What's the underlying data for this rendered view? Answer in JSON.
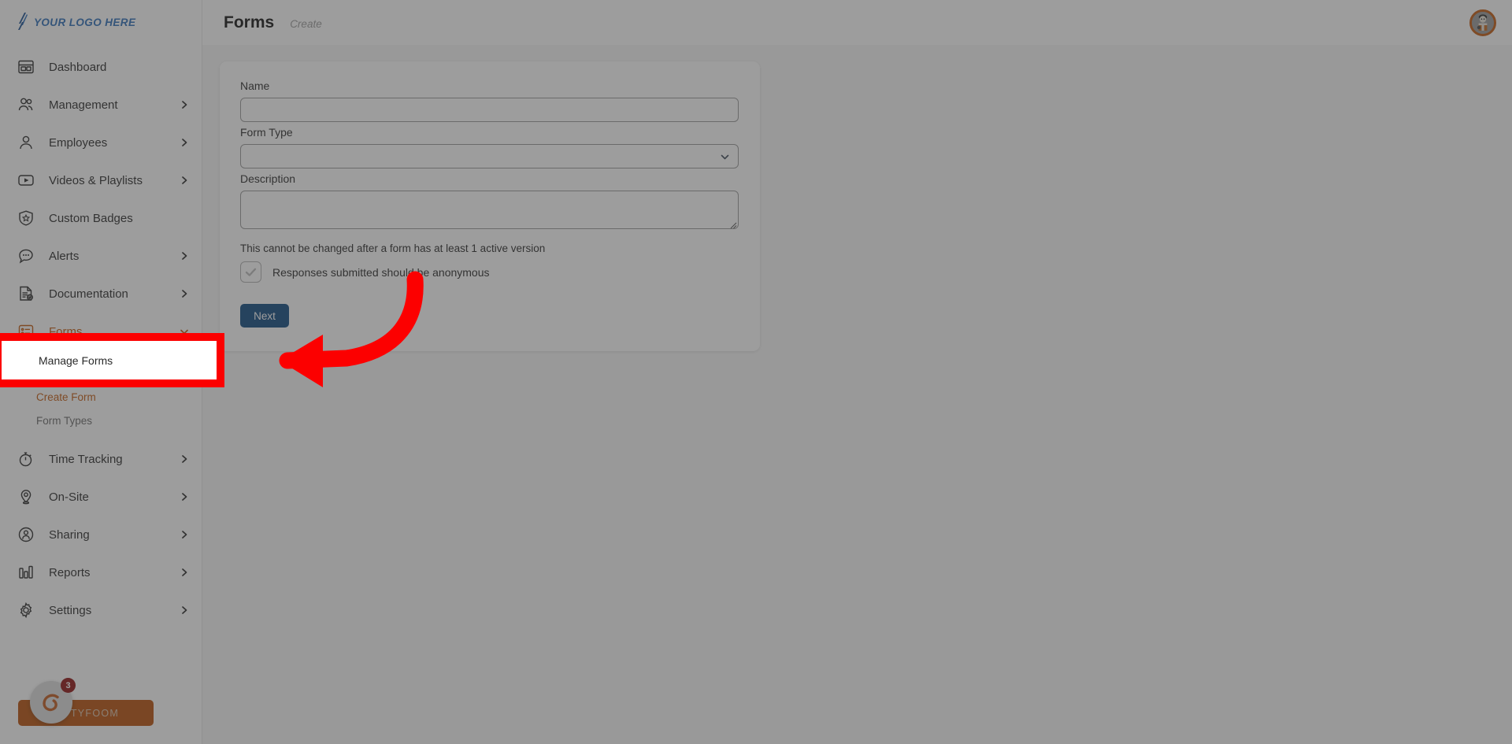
{
  "brand": {
    "logo_text": "YOUR LOGO HERE",
    "logo_color": "#2f6fb8",
    "accent_color": "#c25a10",
    "footer_name": "TYFOOM",
    "footer_badge_count": "3"
  },
  "sidebar": {
    "items": [
      {
        "label": "Dashboard",
        "icon": "dashboard-icon",
        "chevron": false,
        "active": false
      },
      {
        "label": "Management",
        "icon": "people-icon",
        "chevron": true,
        "active": false
      },
      {
        "label": "Employees",
        "icon": "person-icon",
        "chevron": true,
        "active": false
      },
      {
        "label": "Videos & Playlists",
        "icon": "video-icon",
        "chevron": true,
        "active": false
      },
      {
        "label": "Custom Badges",
        "icon": "shield-star-icon",
        "chevron": false,
        "active": false
      },
      {
        "label": "Alerts",
        "icon": "chat-bubble-icon",
        "chevron": true,
        "active": false
      },
      {
        "label": "Documentation",
        "icon": "document-check-icon",
        "chevron": true,
        "active": false
      },
      {
        "label": "Forms",
        "icon": "form-icon",
        "chevron": true,
        "active": true
      }
    ],
    "forms_subitems": [
      {
        "label": "Manage Forms",
        "active": false
      },
      {
        "label": "Create Form",
        "active": true
      },
      {
        "label": "Form Types",
        "active": false
      }
    ],
    "items_after": [
      {
        "label": "Time Tracking",
        "icon": "stopwatch-icon",
        "chevron": true
      },
      {
        "label": "On-Site",
        "icon": "pin-icon",
        "chevron": true
      },
      {
        "label": "Sharing",
        "icon": "share-user-icon",
        "chevron": true
      },
      {
        "label": "Reports",
        "icon": "bar-chart-icon",
        "chevron": true
      },
      {
        "label": "Settings",
        "icon": "gear-icon",
        "chevron": true
      }
    ]
  },
  "topbar": {
    "title": "Forms",
    "subtitle": "Create",
    "avatar_name": "user-avatar"
  },
  "form": {
    "name_label": "Name",
    "name_value": "",
    "name_placeholder": "",
    "form_type_label": "Form Type",
    "form_type_value": "",
    "description_label": "Description",
    "description_value": "",
    "description_placeholder": "",
    "hint": "This cannot be changed after a form has at least 1 active version",
    "anonymous_label": "Responses submitted should be anonymous",
    "anonymous_checked": false,
    "next_label": "Next"
  },
  "callout": {
    "highlight_label": "Manage Forms",
    "highlight_border_color": "#fc0000",
    "arrow_color": "#fc0000"
  }
}
